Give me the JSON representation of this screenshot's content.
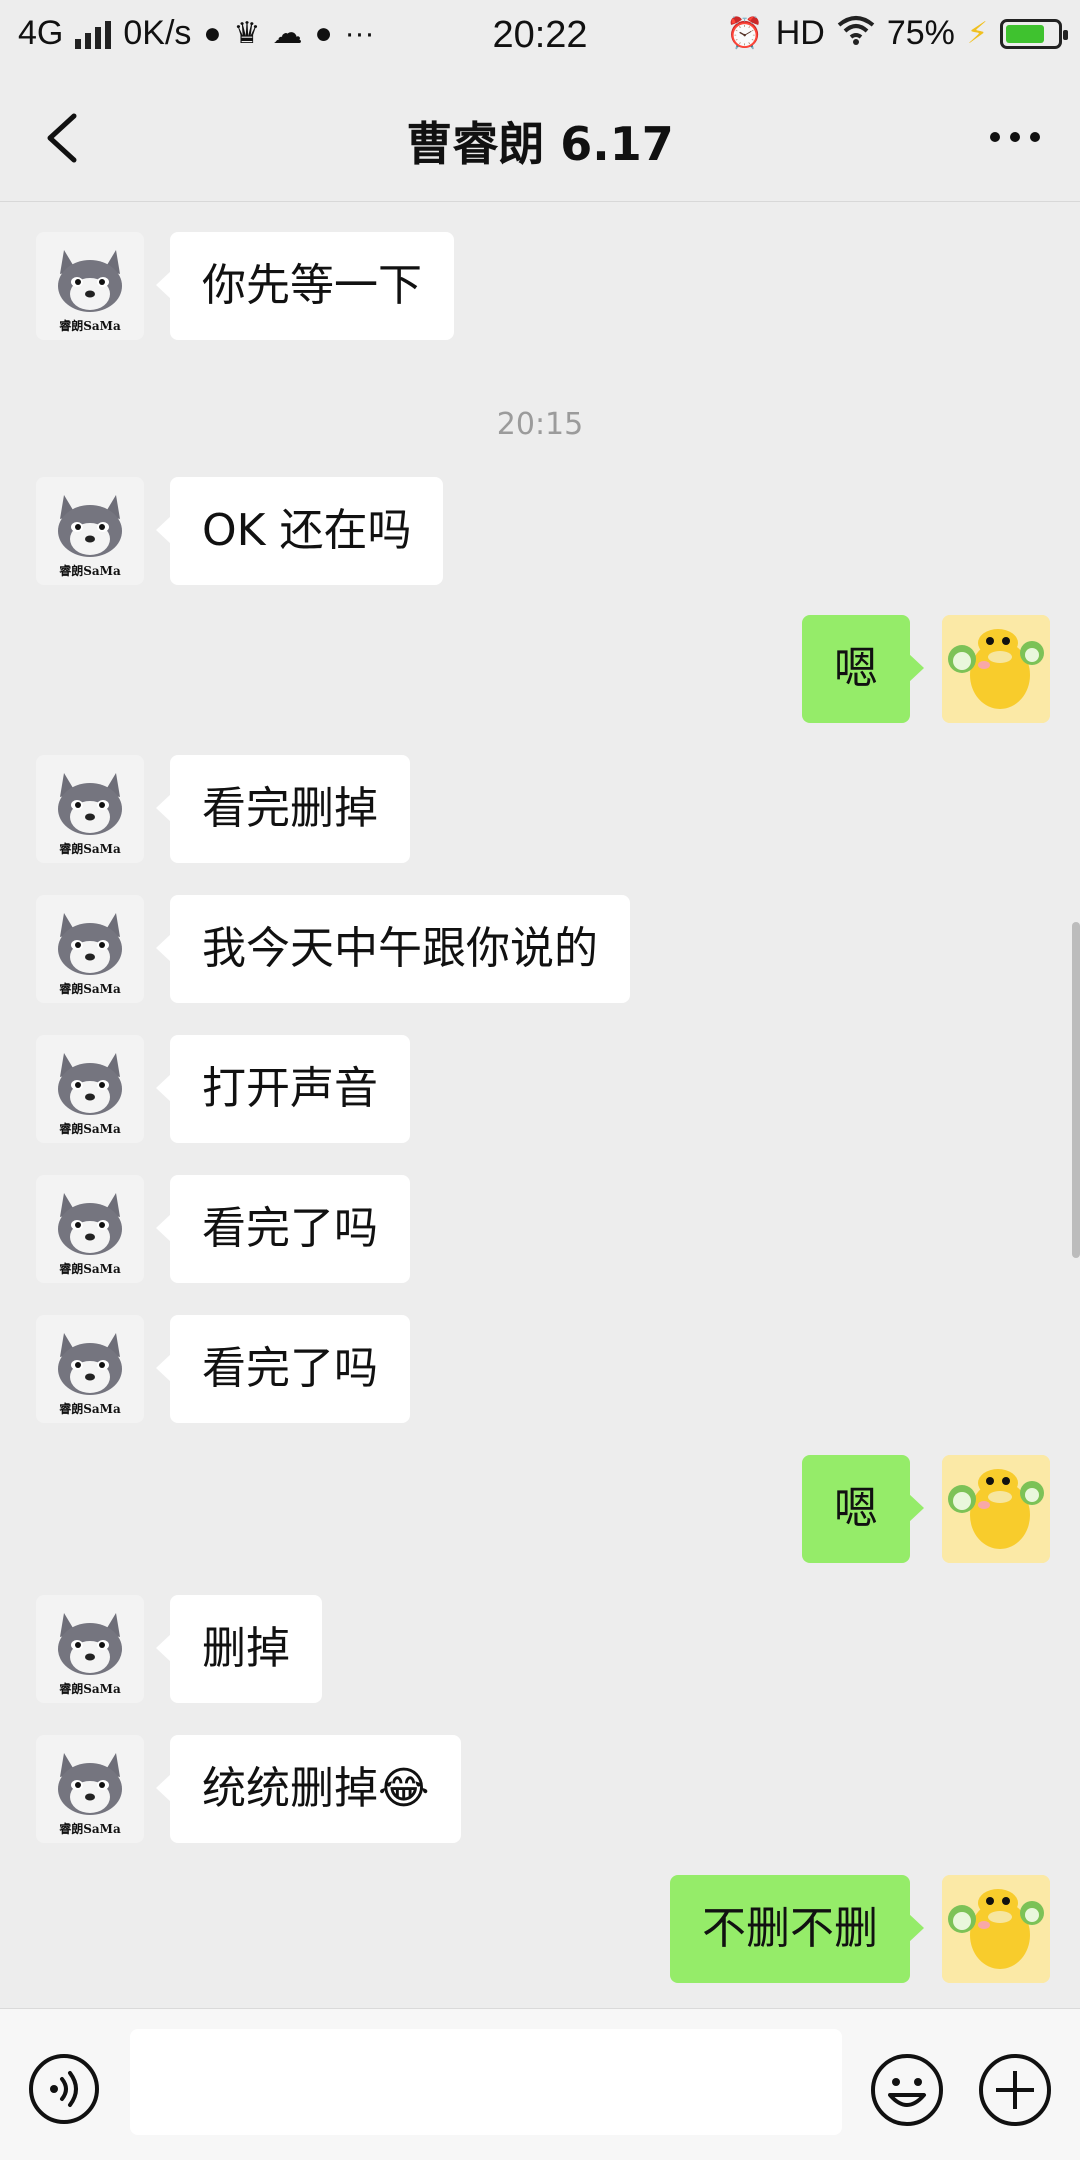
{
  "status_bar": {
    "network": "4G",
    "speed": "0K/s",
    "time": "20:22",
    "hd": "HD",
    "battery": "75%",
    "battery_level": 0.75,
    "battery_color": "#3fc22f"
  },
  "header": {
    "title": "曹睿朗 6.17"
  },
  "chat": {
    "incoming_bubble_color": "#ffffff",
    "outgoing_bubble_color": "#95ec69",
    "messages": [
      {
        "side": "in",
        "text": "你先等一下"
      },
      {
        "timestamp": "20:15"
      },
      {
        "side": "in",
        "text": "OK 还在吗"
      },
      {
        "side": "out",
        "text": "嗯"
      },
      {
        "side": "in",
        "text": "看完删掉"
      },
      {
        "side": "in",
        "text": "我今天中午跟你说的"
      },
      {
        "side": "in",
        "text": "打开声音"
      },
      {
        "side": "in",
        "text": "看完了吗"
      },
      {
        "side": "in",
        "text": "看完了吗"
      },
      {
        "side": "out",
        "text": "嗯"
      },
      {
        "side": "in",
        "text": "删掉"
      },
      {
        "side": "in",
        "text": "统统删掉😂"
      },
      {
        "side": "out",
        "text": "不删不删"
      }
    ],
    "avatar_left_text": "睿朗SaMa"
  },
  "input_bar": {
    "value": ""
  }
}
